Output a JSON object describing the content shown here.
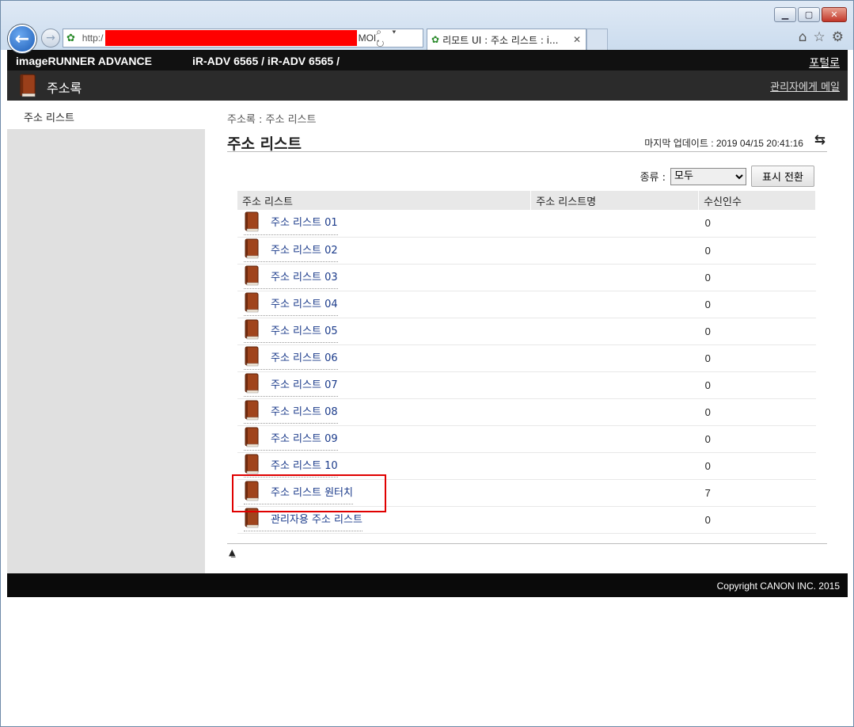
{
  "browser": {
    "url_prefix": "http:/",
    "url_tail": "MOI",
    "url_controls": "⌕ ▾ ↻",
    "tab_title": "리모트 UI : 주소 리스트 : i...",
    "tab_close": "✕",
    "window_buttons": {
      "minimize": "▁",
      "maximize": "▢",
      "close": "✕"
    },
    "tool_icons": {
      "home": "⌂",
      "favorites": "☆",
      "settings": "⚙"
    }
  },
  "header": {
    "brand": "imageRUNNER ADVANCE",
    "model": "iR-ADV 6565 / iR-ADV 6565 /",
    "portal_link": "포털로",
    "section_title": "주소록",
    "admin_mail_link": "관리자에게 메일"
  },
  "sidebar": {
    "items": [
      {
        "label": "주소 리스트"
      }
    ]
  },
  "main": {
    "breadcrumb": "주소록 : 주소 리스트",
    "title": "주소 리스트",
    "last_updated": "마지막 업데이트 : 2019 04/15 20:41:16",
    "filter": {
      "label": "종류 :",
      "selected": "모두",
      "button": "표시 전환"
    },
    "columns": [
      "주소 리스트",
      "주소 리스트명",
      "수신인수"
    ],
    "rows": [
      {
        "name": "주소 리스트 01",
        "list_name": "",
        "count": "0"
      },
      {
        "name": "주소 리스트 02",
        "list_name": "",
        "count": "0"
      },
      {
        "name": "주소 리스트 03",
        "list_name": "",
        "count": "0"
      },
      {
        "name": "주소 리스트 04",
        "list_name": "",
        "count": "0"
      },
      {
        "name": "주소 리스트 05",
        "list_name": "",
        "count": "0"
      },
      {
        "name": "주소 리스트 06",
        "list_name": "",
        "count": "0"
      },
      {
        "name": "주소 리스트 07",
        "list_name": "",
        "count": "0"
      },
      {
        "name": "주소 리스트 08",
        "list_name": "",
        "count": "0"
      },
      {
        "name": "주소 리스트 09",
        "list_name": "",
        "count": "0"
      },
      {
        "name": "주소 리스트 10",
        "list_name": "",
        "count": "0"
      },
      {
        "name": "주소 리스트 원터치",
        "list_name": "",
        "count": "7"
      },
      {
        "name": "관리자용 주소 리스트",
        "list_name": "",
        "count": "0"
      }
    ],
    "highlight_color": "#e00000"
  },
  "footer": {
    "copyright": "Copyright CANON INC. 2015"
  }
}
